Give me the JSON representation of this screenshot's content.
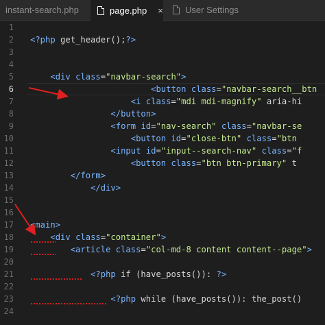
{
  "colors": {
    "background": "#1e1e1e",
    "tabbar": "#2b2b2b",
    "line_number": "#6b6b6b",
    "tag": "#7ab5ff",
    "attr": "#7ab5ff",
    "string": "#c3e88d",
    "text": "#d8d8d8",
    "keyword": "#e0e0e0",
    "squiggle": "#e02020",
    "arrow": "#e02020"
  },
  "tabs": [
    {
      "label": "instant-search.php",
      "active": false,
      "icon": "none"
    },
    {
      "label": "page.php",
      "active": true,
      "icon": "file-icon",
      "close": "×"
    },
    {
      "label": "User Settings",
      "active": false,
      "icon": "file-icon"
    }
  ],
  "editor": {
    "current_line": 6,
    "lines": [
      {
        "n": "1",
        "code": ""
      },
      {
        "n": "2",
        "code": "<?php get_header();?>"
      },
      {
        "n": "3",
        "code": ""
      },
      {
        "n": "4",
        "code": ""
      },
      {
        "n": "5",
        "code": "    <div class=\"navbar-search\">"
      },
      {
        "n": "6",
        "code": "                        <button class=\"navbar-search__btn"
      },
      {
        "n": "7",
        "code": "                    <i class=\"mdi mdi-magnify\" aria-hi"
      },
      {
        "n": "8",
        "code": "                </button>"
      },
      {
        "n": "9",
        "code": "                <form id=\"nav-search\" class=\"navbar-se"
      },
      {
        "n": "10",
        "code": "                    <button id=\"close-btn\" class=\"btn"
      },
      {
        "n": "11",
        "code": "                <input id=\"input--search-nav\" class=\"f"
      },
      {
        "n": "12",
        "code": "                    <button class=\"btn btn-primary\" t"
      },
      {
        "n": "13",
        "code": "        </form>"
      },
      {
        "n": "14",
        "code": "            </div>"
      },
      {
        "n": "15",
        "code": ""
      },
      {
        "n": "16",
        "code": ""
      },
      {
        "n": "17",
        "code": "<main>"
      },
      {
        "n": "18",
        "code": "    <div class=\"container\">"
      },
      {
        "n": "19",
        "code": "        <article class=\"col-md-8 content content--page\">"
      },
      {
        "n": "20",
        "code": ""
      },
      {
        "n": "21",
        "code": "            <?php if (have_posts()): ?>"
      },
      {
        "n": "22",
        "code": ""
      },
      {
        "n": "23",
        "code": "                <?php while (have_posts()): the_post()"
      },
      {
        "n": "24",
        "code": ""
      }
    ]
  }
}
